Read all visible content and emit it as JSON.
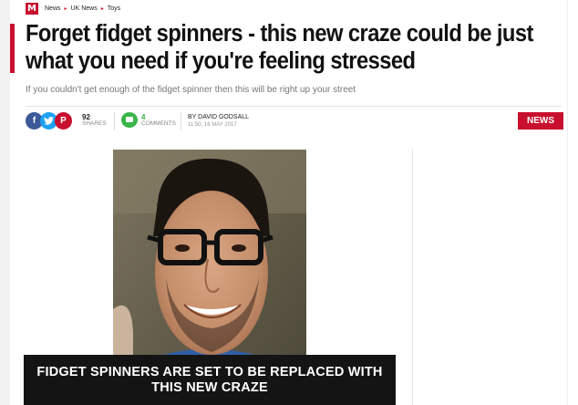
{
  "logo": "M",
  "breadcrumb": [
    "News",
    "UK News",
    "Toys"
  ],
  "headline": "Forget fidget spinners - this new craze could be just what you need if you're feeling stressed",
  "subheadline": "If you couldn't get enough of the fidget spinner then this will be right up your street",
  "social": {
    "shares_count": "92",
    "shares_label": "SHARES",
    "comments_count": "4",
    "comments_label": "COMMENTS"
  },
  "author": {
    "byline": "BY DAVID GODSALL",
    "date": "11:50, 16 MAY 2017"
  },
  "badge": "NEWS",
  "image_caption": "FIDGET SPINNERS ARE SET TO BE REPLACED WITH THIS NEW CRAZE",
  "colors": {
    "brand": "#c8102e",
    "facebook": "#3b5998",
    "twitter": "#1da1f2",
    "comments": "#39b54a"
  },
  "icons": [
    "facebook-icon",
    "twitter-icon",
    "pinterest-icon",
    "comment-icon"
  ]
}
